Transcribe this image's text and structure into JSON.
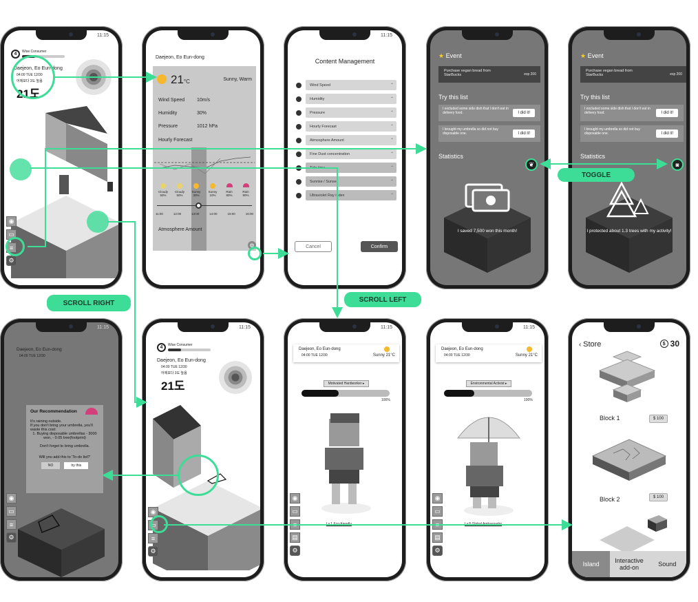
{
  "status_time": "11:15",
  "labels": {
    "scroll_right": "SCROLL RIGHT",
    "scroll_left": "SCROLL LEFT",
    "toggle": "TOGGLE"
  },
  "colors": {
    "accent": "#3ddc97",
    "gray_bg": "#777777",
    "dark": "#1d1d1d"
  },
  "home": {
    "level": "4",
    "level_title": "Wise Consumer",
    "location": "Daejeon, Eo Eun-dong",
    "datetime": "04:00 TUE 12/30",
    "korean_note": "어제보다 3도 높음",
    "temp": "21도"
  },
  "weather": {
    "location": "Daejeon, Eo Eun-dong",
    "temp": "21",
    "unit": "°C",
    "summary": "Sunny, Warm",
    "rows": [
      {
        "label": "Wind Speed",
        "value": "10m/s"
      },
      {
        "label": "Humidity",
        "value": "30%"
      },
      {
        "label": "Pressure",
        "value": "1012 hPa"
      }
    ],
    "forecast_title": "Hourly Forecast",
    "hours": [
      {
        "cond": "Cloudy",
        "pct": "50%",
        "time": "11:00"
      },
      {
        "cond": "Cloudy",
        "pct": "50%",
        "time": "12:00"
      },
      {
        "cond": "Sunny",
        "pct": "30%",
        "time": "13:00"
      },
      {
        "cond": "Sunny",
        "pct": "10%",
        "time": "14:00"
      },
      {
        "cond": "Rain",
        "pct": "80%",
        "time": "15:00"
      },
      {
        "cond": "Rain",
        "pct": "90%",
        "time": "16:00"
      }
    ],
    "atmosphere": "Atmosphere Amount"
  },
  "content_mgmt": {
    "title": "Content Management",
    "items": [
      "Wind Speed",
      "Humidity",
      "Pressure",
      "Hourly Forecast",
      "Atmosphere Amount",
      "Fine Dust concentration",
      "Tide time",
      "Sunrise / Sunset",
      "Ultraviolet Ray index"
    ],
    "cancel": "Cancel",
    "confirm": "Confirm"
  },
  "event_a": {
    "event_title": "Event",
    "event_text": "Purchase vegan bread from StarBucks",
    "event_exp": "exp 200",
    "try_title": "Try this list",
    "tasks": [
      {
        "text": "I excluded some side dish that I don't eat in delivery food.",
        "btn": "I did it!"
      },
      {
        "text": "I brought my umbrella so did not buy disposable one.",
        "btn": "I did it!"
      }
    ],
    "stats_title": "Statistics",
    "stat_text": "I saved 7,500 won this month!"
  },
  "event_b": {
    "event_title": "Event",
    "event_text": "Purchase vegan bread from StarBucks",
    "event_exp": "exp 200",
    "try_title": "Try this list",
    "tasks": [
      {
        "text": "I excluded some side dish that I don't eat in delivery food.",
        "btn": "I did it!"
      },
      {
        "text": "I brought my umbrella so did not buy disposable one.",
        "btn": "I did it!"
      }
    ],
    "stats_title": "Statistics",
    "stat_text": "I protected about 1.3 trees with my activity!"
  },
  "recommendation": {
    "location": "Daejeon, Eo Eun-dong",
    "datetime": "04:00 TUE 12/30",
    "title": "Our Recommendation",
    "body1": "It's raining outside.",
    "body2": "If you don't bring your umbrella, you'll waste this cost:",
    "body3": "1. Buying disposable umbrellas - 3000 won, - 0.05 tree(footprint)",
    "body4": "Don't forget to bring umbrella.",
    "question": "Will you add this to 'To-do list?'",
    "no": "NO",
    "yes": "try this"
  },
  "home2": {
    "level": "4",
    "level_title": "Wise Consumer",
    "location": "Daejeon, Eo Eun-dong",
    "datetime": "04:00 TUE 12/30",
    "korean_note": "어제보다 3도 높음",
    "temp": "21도"
  },
  "char_a": {
    "location": "Daejeon, Eo Eun-dong",
    "datetime": "04:00 TUE 12/30",
    "weather": "Sunny 21°C",
    "badge": "Motivated Hardworker ▸",
    "pct": "100%",
    "progress": 0.42,
    "footer": "Lv.1 Eco-friendly"
  },
  "char_b": {
    "location": "Daejeon, Eo Eun-dong",
    "datetime": "04:00 TUE 12/30",
    "weather": "Sunny 21°C",
    "badge": "Environmental Activist ▸",
    "pct": "100%",
    "progress": 0.34,
    "footer": "Lv.8 Global Ambassador"
  },
  "store": {
    "title": "Store",
    "coins": "30",
    "blocks": [
      {
        "name": "Block 1",
        "price": "100"
      },
      {
        "name": "Block 2",
        "price": "100"
      }
    ],
    "tabs": [
      "Island",
      "Interactive add-on",
      "Sound"
    ]
  }
}
